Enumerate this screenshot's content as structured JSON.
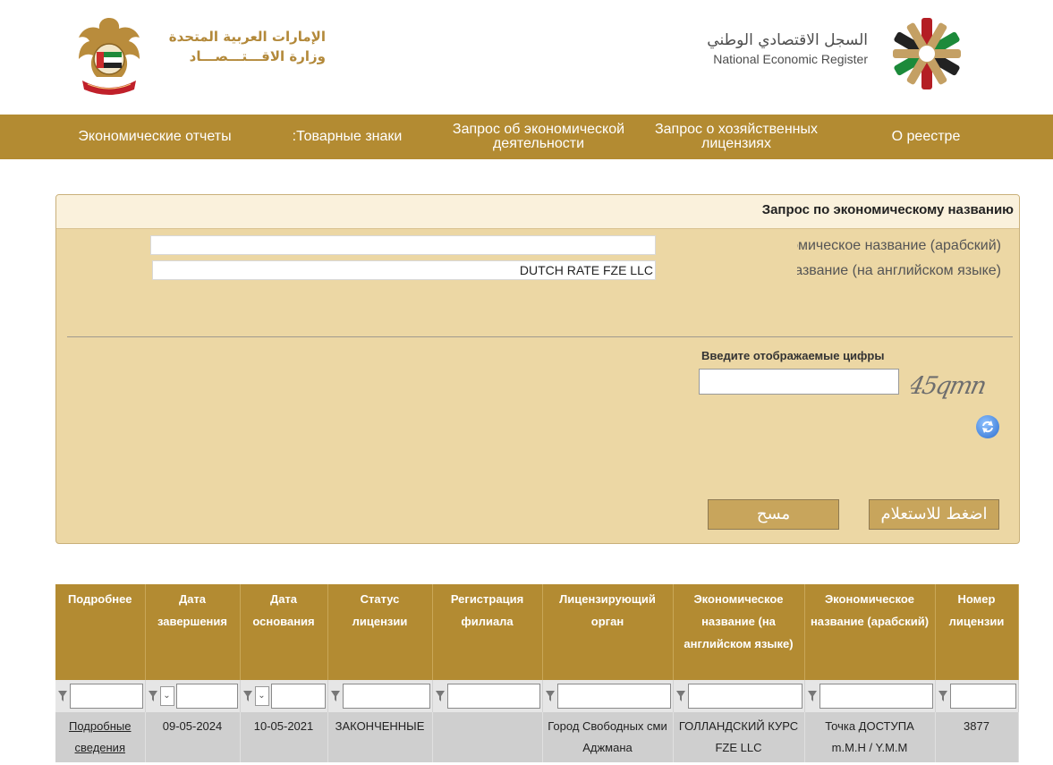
{
  "header": {
    "uae_ar_line1": "الإمارات العربية المتحدة",
    "uae_ar_line2": "وزارة الاقـــتـــصـــاد",
    "register_ar": "السجل الاقتصادي الوطني",
    "register_en": "National Economic Register"
  },
  "nav": {
    "items": [
      "Экономические отчеты",
      ":Товарные знаки",
      "Запрос об экономической деятельности",
      "Запрос о хозяйственных лицензиях",
      "О реестре"
    ]
  },
  "search": {
    "title": "Запрос по экономическому названию",
    "label_arabic": "Экономическое название (арабский)",
    "label_english": "Экономическое название (на английском языке)",
    "value_arabic": "",
    "value_english": "DUTCH RATE FZE LLC",
    "captcha_label": "Введите отображаемые цифры",
    "captcha_text": "45qmn",
    "submit_label": "اضغط للاستعلام",
    "clear_label": "مسح"
  },
  "table": {
    "headers": [
      "Подробнее",
      "Дата завершения",
      "Дата основания",
      "Статус лицензии",
      "Регистрация филиала",
      "Лицензирующий орган",
      "Экономическое название (на английском языке)",
      "Экономическое название (арабский)",
      "Номер лицензии"
    ],
    "rows": [
      {
        "details": "Подробные сведения",
        "end_date": "09-05-2024",
        "start_date": "10-05-2021",
        "status": "ЗАКОНЧЕННЫЕ",
        "branch": "",
        "authority": "Город Свободных сми Аджмана",
        "name_en": "ГОЛЛАНДСКИЙ КУРС FZE LLC",
        "name_ar": "Точка ДОСТУПА m.M.H / Y.M.M",
        "license_no": "3877"
      }
    ]
  },
  "colors": {
    "nav_bg": "#b38b32",
    "panel_bg": "#ecd7a4",
    "panel_header_bg": "#faf1dc",
    "button_bg": "#c8a55c",
    "row_bg": "#cfcfcf"
  }
}
